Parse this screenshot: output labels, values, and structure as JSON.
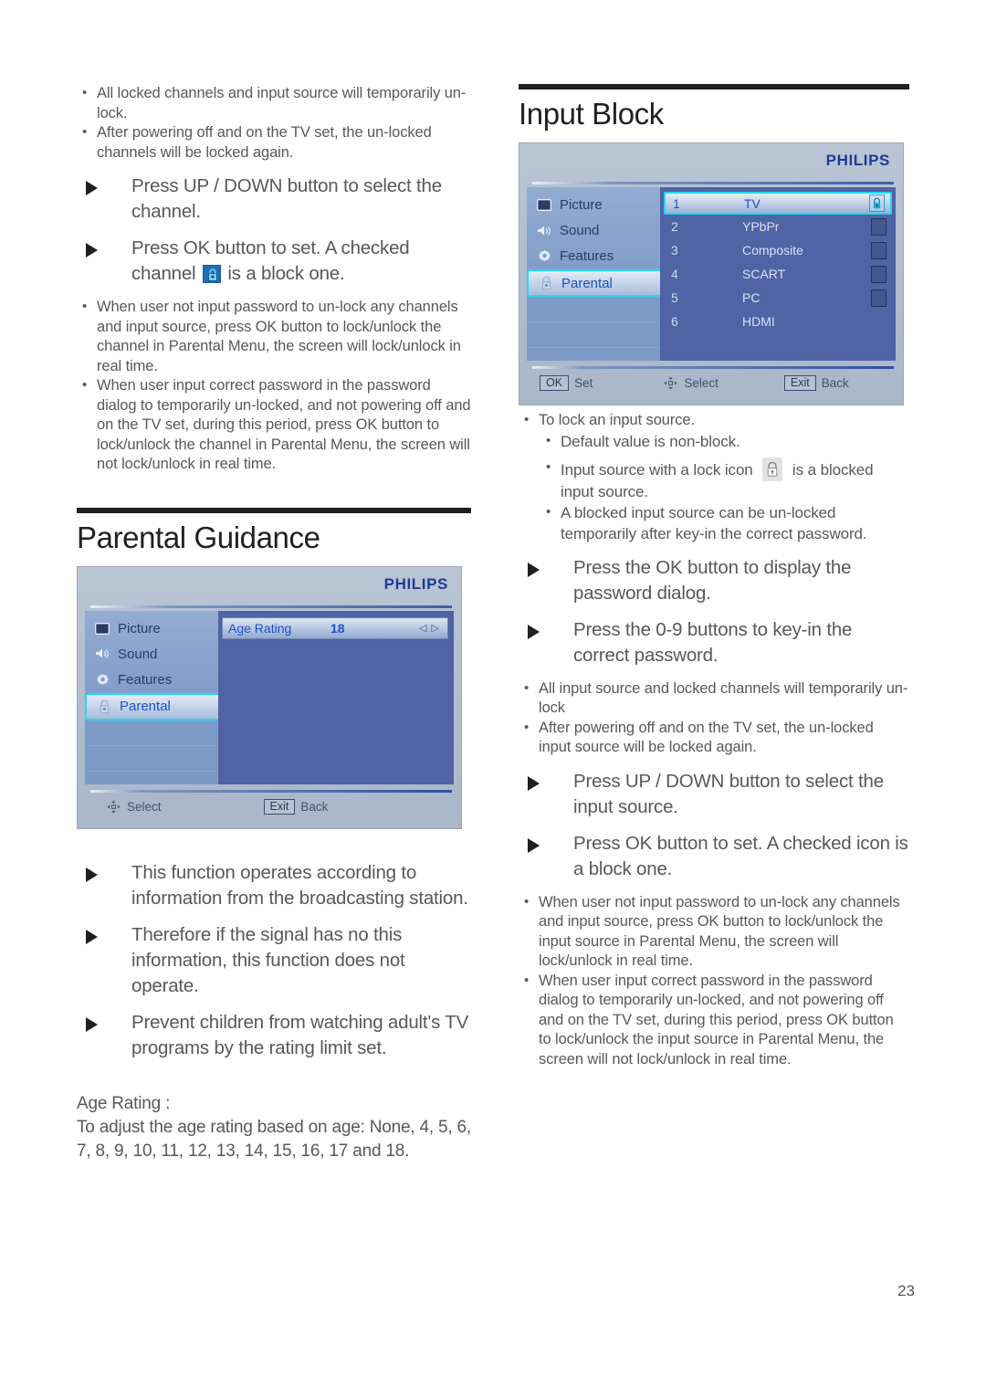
{
  "page": {
    "number": "23"
  },
  "left_column": {
    "top_notes": [
      "All locked channels and input source will temporarily un-lock.",
      "After powering off and on the TV set, the un-locked channels will be locked again."
    ],
    "arrow_items": [
      "Press UP / DOWN button to select the channel.",
      "Press OK button to set. A checked"
    ],
    "arrow_item_2_tail": "is a block one.",
    "arrow_item_2_word": "channel",
    "mid_notes": [
      "When user not input password to un-lock any channels and input source, press OK button to lock/unlock the channel in Parental Menu, the screen will lock/unlock in real time.",
      "When user input correct password in the password dialog to temporarily un-locked, and not powering off and on the TV set, during this period, press OK button to lock/unlock the channel in Parental Menu, the screen will not lock/unlock in real time."
    ],
    "section": {
      "title": "Parental Guidance"
    },
    "osd": {
      "brand": "PHILIPS",
      "sidebar": [
        {
          "label": "Picture",
          "icon": "tv-screen-icon",
          "selected": false
        },
        {
          "label": "Sound",
          "icon": "speaker-icon",
          "selected": false
        },
        {
          "label": "Features",
          "icon": "gear-icon",
          "selected": false
        },
        {
          "label": "Parental",
          "icon": "padlock-icon",
          "selected": true
        }
      ],
      "row": {
        "label": "Age Rating",
        "value": "18",
        "arrows": "◁ ▷"
      },
      "footer": [
        {
          "key": "",
          "icon": "nav-pad-icon",
          "label": "Select"
        },
        {
          "key": "Exit",
          "icon": "",
          "label": "Back"
        }
      ]
    },
    "arrow_notes": [
      "This function operates according to information from the broadcasting station.",
      "Therefore if the signal has no this information, this function does not operate.",
      "Prevent children from watching adult's TV programs by the rating limit set."
    ],
    "age_rating_heading": "Age Rating :",
    "age_rating_body": "To adjust the age rating based on age: None, 4, 5, 6, 7, 8, 9, 10, 11, 12, 13, 14, 15, 16, 17 and 18."
  },
  "right_column": {
    "section": {
      "title": "Input Block"
    },
    "osd": {
      "brand": "PHILIPS",
      "sidebar": [
        {
          "label": "Picture",
          "icon": "tv-screen-icon",
          "selected": false
        },
        {
          "label": "Sound",
          "icon": "speaker-icon",
          "selected": false
        },
        {
          "label": "Features",
          "icon": "gear-icon",
          "selected": false
        },
        {
          "label": "Parental",
          "icon": "padlock-icon",
          "selected": true
        }
      ],
      "inputs": [
        {
          "num": "1",
          "name": "TV",
          "selected": true,
          "locked": true
        },
        {
          "num": "2",
          "name": "YPbPr",
          "selected": false,
          "locked": false
        },
        {
          "num": "3",
          "name": "Composite",
          "selected": false,
          "locked": false
        },
        {
          "num": "4",
          "name": "SCART",
          "selected": false,
          "locked": false
        },
        {
          "num": "5",
          "name": "PC",
          "selected": false,
          "locked": false
        },
        {
          "num": "6",
          "name": "HDMI",
          "selected": false,
          "locked": false
        }
      ],
      "footer": [
        {
          "key": "OK",
          "icon": "",
          "label": "Set"
        },
        {
          "key": "",
          "icon": "nav-pad-icon",
          "label": "Select"
        },
        {
          "key": "Exit",
          "icon": "",
          "label": "Back"
        }
      ]
    },
    "note_lock_input": "To lock an input source.",
    "sub_notes_a": [
      "Default value is non-block."
    ],
    "lock_icon_note_pre": "Input source with a lock icon",
    "lock_icon_note_post": "is a blocked input source.",
    "sub_notes_b": [
      "A blocked input source can be un-locked temporarily after key-in the correct password."
    ],
    "arrow_items_a": [
      "Press the OK button to display the password dialog.",
      "Press the 0-9 buttons to key-in the correct password."
    ],
    "notes_b": [
      "All input source and locked channels will temporarily un-lock",
      "After powering off and on the TV set, the un-locked input source will be locked again."
    ],
    "arrow_items_b": [
      "Press UP / DOWN button to select the input source.",
      "Press OK button to set. A checked icon is a block one."
    ],
    "notes_c": [
      "When user not input password to un-lock any channels and input source, press OK button to lock/unlock the input source in Parental Menu, the screen will lock/unlock in real time.",
      "When user input correct password in the password dialog to temporarily un-locked, and not powering off and on the TV set, during this period, press OK button to lock/unlock the input source in Parental Menu, the screen will not lock/unlock in real time."
    ]
  },
  "colors": {
    "text": "#58585a",
    "heading": "#231f20",
    "brand_blue": "#1b3c96",
    "osd_accent": "#22d8f5",
    "osd_main": "#4f63a5"
  }
}
